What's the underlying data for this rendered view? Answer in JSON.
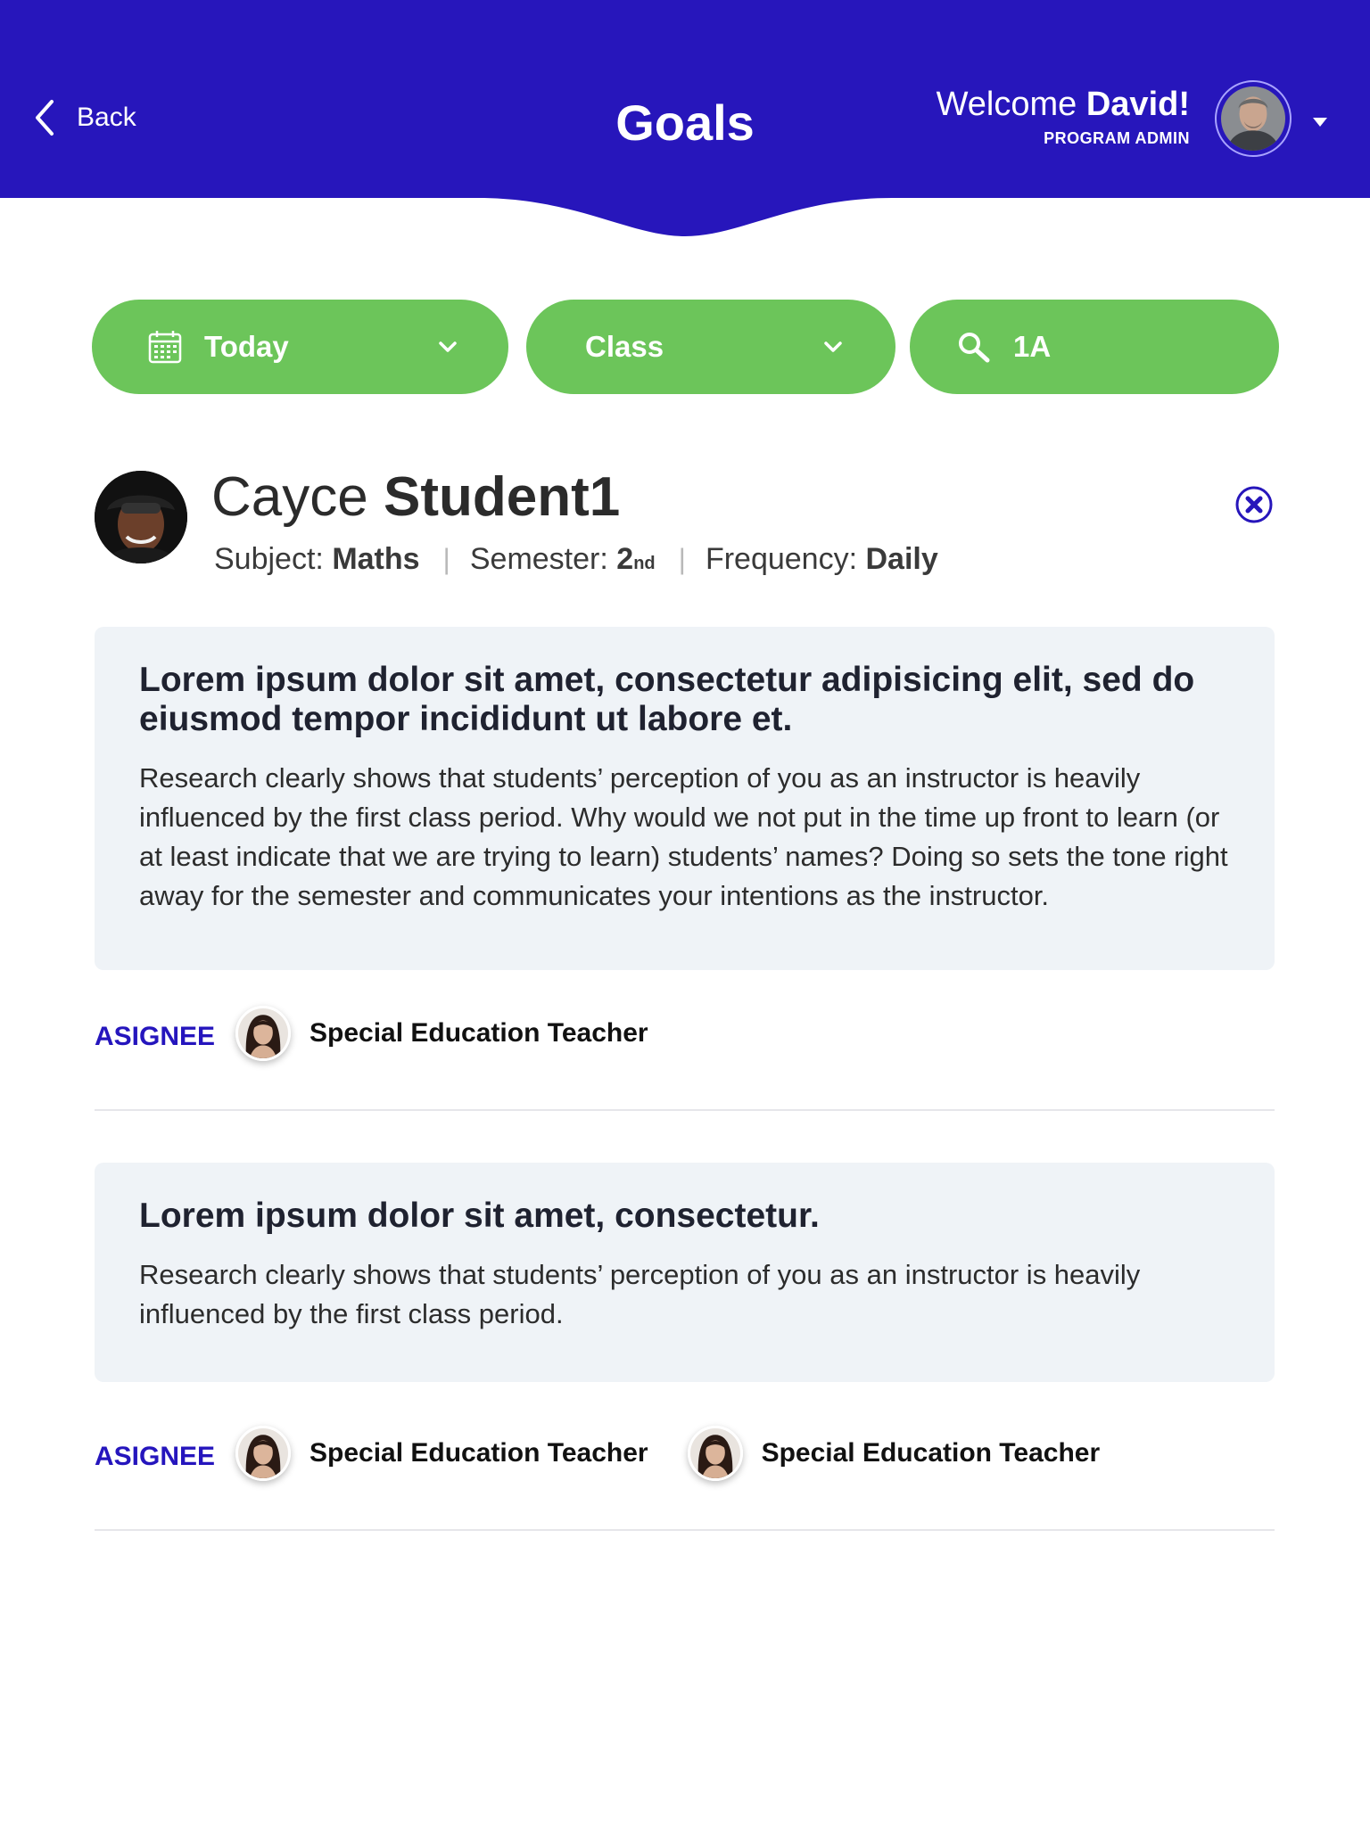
{
  "header": {
    "back_label": "Back",
    "title": "Goals",
    "welcome_prefix": "Welcome",
    "user_name": "David!",
    "role": "PROGRAM ADMIN",
    "bg_color": "#2716bb"
  },
  "filters": {
    "date_label": "Today",
    "class_label": "Class",
    "search_value": "1A",
    "pill_color": "#6cc55a"
  },
  "student": {
    "first_name": "Cayce",
    "last_name": "Student1",
    "subject_label": "Subject:",
    "subject_value": "Maths",
    "semester_label": "Semester:",
    "semester_value": "2",
    "semester_suffix": "nd",
    "frequency_label": "Frequency:",
    "frequency_value": "Daily"
  },
  "goals": [
    {
      "title": "Lorem ipsum dolor sit amet, consectetur adipisicing elit, sed do eiusmod tempor incididunt ut labore et.",
      "description": "Research clearly shows that students’ perception of you as an instructor is heavily influenced by the first class period. Why would we not put in the time up front to learn (or at least indicate that we are trying to learn) students’ names? Doing so sets the tone right away for the semester and communicates your intentions as the instructor.",
      "assignee_label": "ASIGNEE",
      "assignees": [
        "Special Education Teacher"
      ]
    },
    {
      "title": "Lorem ipsum dolor sit amet, consectetur.",
      "description": "Research clearly shows that students’ perception of you as an instructor is heavily influenced by the first class period.",
      "assignee_label": "ASIGNEE",
      "assignees": [
        "Special Education Teacher",
        "Special Education Teacher"
      ]
    }
  ]
}
